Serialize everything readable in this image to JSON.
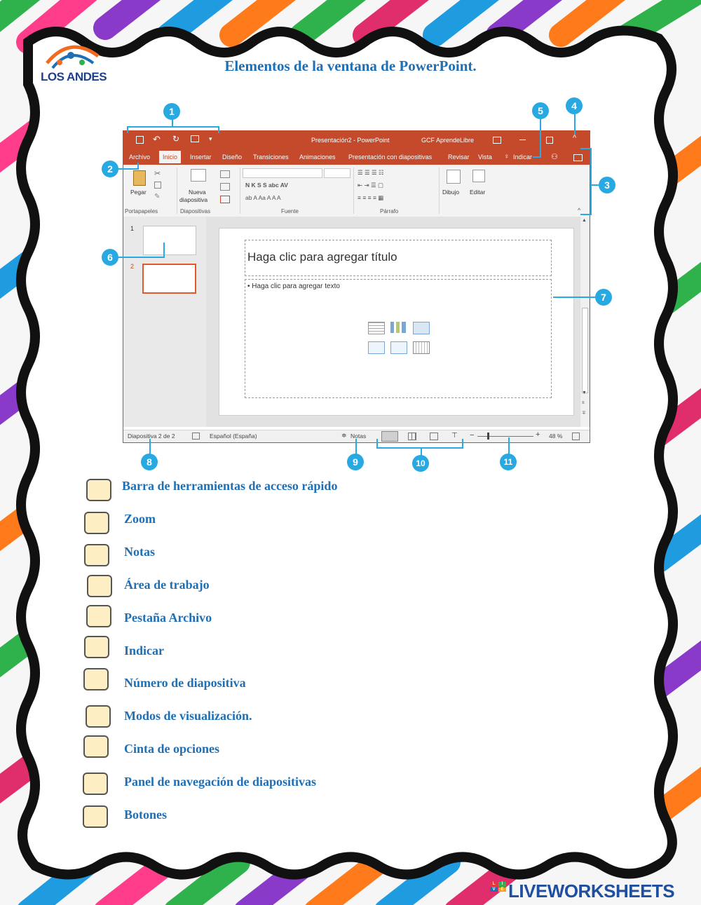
{
  "logo": {
    "name": "LOS ANDES",
    "arc_text": "UNIDAD ED"
  },
  "title": "Elementos de la ventana de PowerPoint.",
  "ppt": {
    "window_title": "Presentación2 - PowerPoint",
    "account": "GCF AprendeLibre",
    "tabs": [
      "Archivo",
      "Inicio",
      "Insertar",
      "Diseño",
      "Transiciones",
      "Animaciones",
      "Presentación con diapositivas",
      "Revisar",
      "Vista",
      "Indicar"
    ],
    "active_tab": "Inicio",
    "ribbon": {
      "pegar": "Pegar",
      "nueva": "Nueva",
      "diapositiva": "diapositiva",
      "dibujo": "Dibujo",
      "editar": "Editar",
      "group_portapapeles": "Portapapeles",
      "group_diapositivas": "Diapositivas",
      "group_fuente": "Fuente",
      "group_parrafo": "Párrafo"
    },
    "thumbs": [
      "1",
      "2"
    ],
    "slide_title": "Haga clic para agregar título",
    "slide_text": "• Haga clic para agregar texto",
    "status": {
      "slide_count": "Diapositiva 2 de 2",
      "language": "Español (España)",
      "notes": "Notas",
      "zoom": "48 %"
    }
  },
  "callouts": [
    "1",
    "2",
    "3",
    "4",
    "5",
    "6",
    "7",
    "8",
    "9",
    "10",
    "11"
  ],
  "items": [
    "Barra de herramientas de acceso rápido",
    "Zoom",
    "Notas",
    "Área de trabajo",
    "Pestaña Archivo",
    "Indicar",
    "Número de diapositiva",
    "Modos de visualización.",
    "Cinta de opciones",
    "Panel de navegación de diapositivas",
    "Botones"
  ],
  "brand": "LIVEWORKSHEETS",
  "brand_icon": "LIVE",
  "colors": {
    "accent": "#c44a2b",
    "callout": "#29a9e1",
    "label": "#1f6fb5",
    "checkbox": "#fdeec4"
  }
}
